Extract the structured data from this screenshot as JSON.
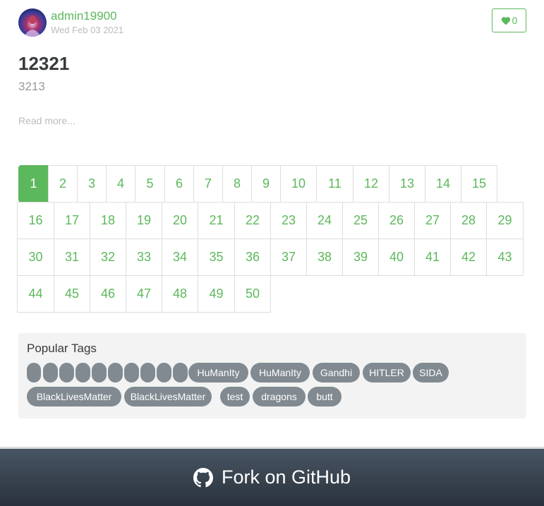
{
  "article": {
    "author": "admin19900",
    "date": "Wed Feb 03 2021",
    "favorites_count": "0",
    "title": "12321",
    "description": "3213",
    "read_more": "Read more..."
  },
  "pagination": {
    "pages": [
      "1",
      "2",
      "3",
      "4",
      "5",
      "6",
      "7",
      "8",
      "9",
      "10",
      "11",
      "12",
      "13",
      "14",
      "15",
      "16",
      "17",
      "18",
      "19",
      "20",
      "21",
      "22",
      "23",
      "24",
      "25",
      "26",
      "27",
      "28",
      "29",
      "30",
      "31",
      "32",
      "33",
      "34",
      "35",
      "36",
      "37",
      "38",
      "39",
      "40",
      "41",
      "42",
      "43",
      "44",
      "45",
      "46",
      "47",
      "48",
      "49",
      "50"
    ],
    "active": "1"
  },
  "tags": {
    "title": "Popular Tags",
    "items": [
      "",
      "",
      "",
      "",
      "",
      "",
      "",
      "",
      "",
      "",
      "HuManIty",
      "HuManIty",
      "Gandhi",
      "HITLER",
      "SIDA",
      "BlackLivesMatter",
      "BlackLivesMatter",
      "test",
      "dragons",
      "butt"
    ]
  },
  "footer": {
    "text": "Fork on GitHub"
  },
  "colors": {
    "accent": "#5cb85c",
    "tag_bg": "#818a91",
    "footer_top": "#485563",
    "footer_bottom": "#29323c"
  }
}
